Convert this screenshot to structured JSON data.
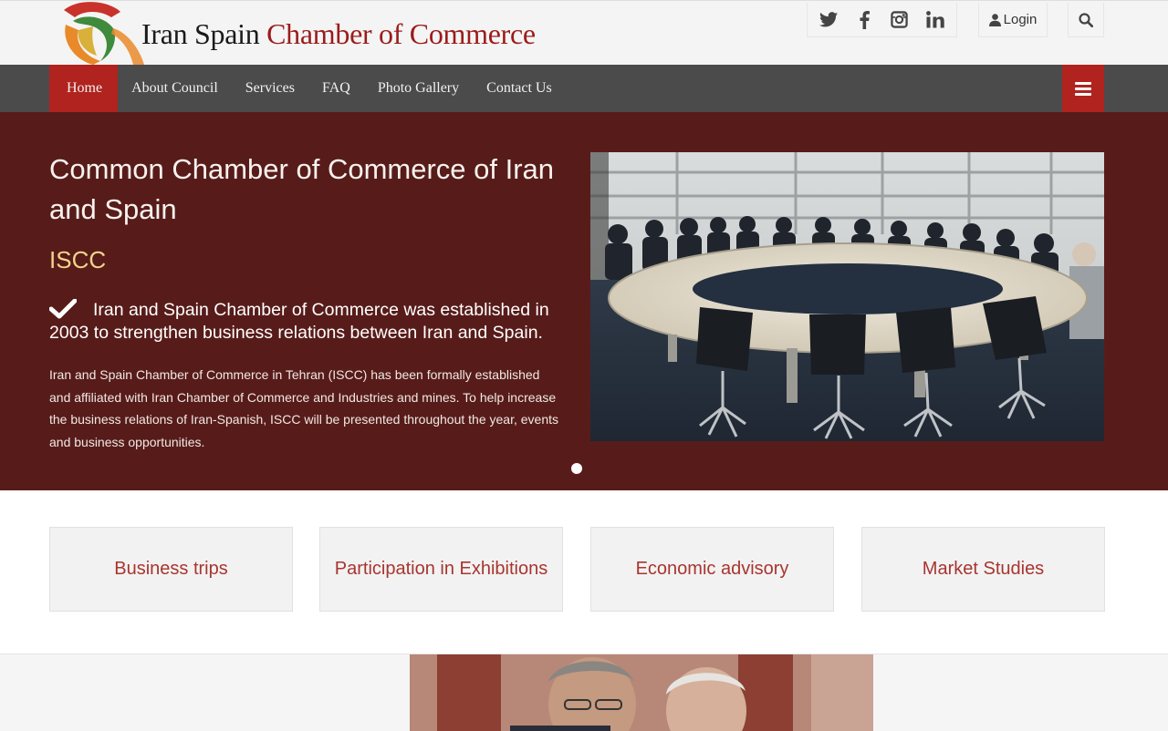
{
  "header": {
    "brand_part1": "Iran Spain",
    "brand_part2": "Chamber of Commerce",
    "social": [
      "twitter-icon",
      "facebook-icon",
      "instagram-icon",
      "linkedin-icon"
    ],
    "login_label": "Login"
  },
  "nav": {
    "items": [
      {
        "label": "Home",
        "active": true
      },
      {
        "label": "About Council"
      },
      {
        "label": "Services"
      },
      {
        "label": "FAQ"
      },
      {
        "label": "Photo Gallery"
      },
      {
        "label": "Contact Us"
      }
    ]
  },
  "hero": {
    "title": "Common Chamber of Commerce of Iran and Spain",
    "subtitle": "ISCC",
    "lead": "Iran and Spain Chamber of Commerce was established in 2003 to strengthen business relations between Iran and Spain.",
    "body": "Iran and Spain Chamber of Commerce in Tehran (ISCC) has been formally established and affiliated with Iran Chamber of Commerce and Industries and mines. To help increase the business relations of Iran-Spanish, ISCC will be presented throughout the year, events and business opportunities."
  },
  "services": [
    {
      "label": "Business trips"
    },
    {
      "label": "Participation in Exhibitions"
    },
    {
      "label": "Economic advisory"
    },
    {
      "label": "Market Studies"
    }
  ],
  "colors": {
    "accent": "#b0231e",
    "hero_bg": "#571c1a",
    "nav_bg": "#4b4b4b",
    "subtitle": "#f2d38a",
    "service_text": "#a8352f"
  }
}
